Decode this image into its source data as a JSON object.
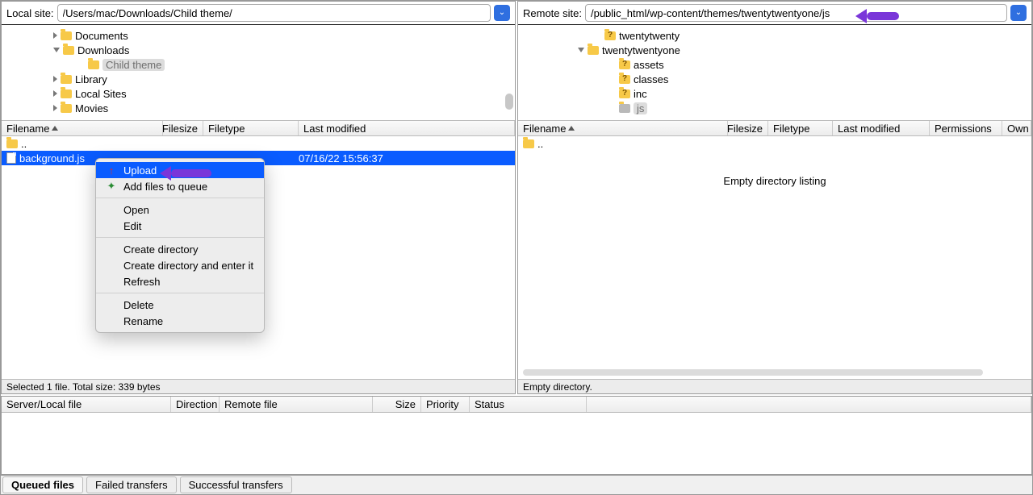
{
  "local": {
    "label": "Local site:",
    "path": "/Users/mac/Downloads/Child theme/",
    "tree": [
      {
        "indent": 60,
        "arrow": "closed",
        "label": "Documents"
      },
      {
        "indent": 60,
        "arrow": "open",
        "label": "Downloads"
      },
      {
        "indent": 90,
        "arrow": "none",
        "label": "Child theme",
        "selected": true
      },
      {
        "indent": 60,
        "arrow": "closed",
        "label": "Library"
      },
      {
        "indent": 60,
        "arrow": "closed",
        "label": "Local Sites"
      },
      {
        "indent": 60,
        "arrow": "closed",
        "label": "Movies"
      }
    ],
    "headers": {
      "filename": "Filename",
      "filesize": "Filesize",
      "filetype": "Filetype",
      "lastmod": "Last modified"
    },
    "parent": "..",
    "file": {
      "name": "background.js",
      "modified": "07/16/22 15:56:37"
    },
    "status": "Selected 1 file. Total size: 339 bytes"
  },
  "remote": {
    "label": "Remote site:",
    "path": "/public_html/wp-content/themes/twentytwentyone/js",
    "tree": [
      {
        "indent": 90,
        "arrow": "none",
        "icon": "q",
        "label": "twentytwenty"
      },
      {
        "indent": 70,
        "arrow": "open",
        "icon": "folder",
        "label": "twentytwentyone"
      },
      {
        "indent": 108,
        "arrow": "none",
        "icon": "q",
        "label": "assets"
      },
      {
        "indent": 108,
        "arrow": "none",
        "icon": "q",
        "label": "classes"
      },
      {
        "indent": 108,
        "arrow": "none",
        "icon": "q",
        "label": "inc"
      },
      {
        "indent": 108,
        "arrow": "none",
        "icon": "sel",
        "label": "js",
        "selected": true
      }
    ],
    "headers": {
      "filename": "Filename",
      "filesize": "Filesize",
      "filetype": "Filetype",
      "lastmod": "Last modified",
      "permissions": "Permissions",
      "owner": "Own"
    },
    "parent": "..",
    "empty": "Empty directory listing",
    "status": "Empty directory."
  },
  "context_menu": {
    "upload": "Upload",
    "add_queue": "Add files to queue",
    "open": "Open",
    "edit": "Edit",
    "create_dir": "Create directory",
    "create_enter": "Create directory and enter it",
    "refresh": "Refresh",
    "delete": "Delete",
    "rename": "Rename"
  },
  "queue": {
    "headers": {
      "server": "Server/Local file",
      "direction": "Direction",
      "remote": "Remote file",
      "size": "Size",
      "priority": "Priority",
      "status": "Status"
    }
  },
  "tabs": {
    "queued": "Queued files",
    "failed": "Failed transfers",
    "success": "Successful transfers"
  }
}
